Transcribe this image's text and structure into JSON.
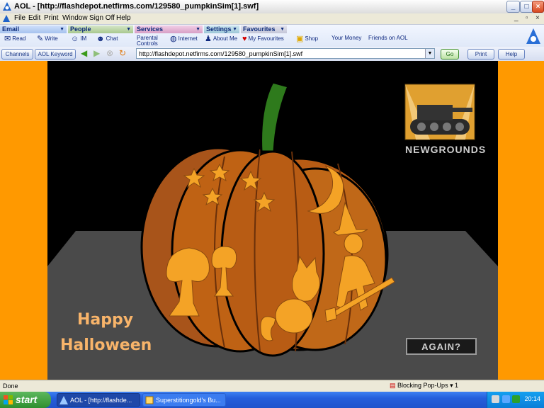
{
  "window": {
    "title": "AOL - [http://flashdepot.netfirms.com/129580_pumpkinSim[1].swf]"
  },
  "menu": [
    "File",
    "Edit",
    "Print",
    "Window",
    "Sign Off",
    "Help"
  ],
  "toolbar": {
    "groups": [
      {
        "label": "Email",
        "items": [
          "Read",
          "Write"
        ]
      },
      {
        "label": "People",
        "items": [
          "IM",
          "Chat"
        ]
      },
      {
        "label": "Services",
        "items": [
          "Parental Controls",
          "Internet",
          "About Me"
        ]
      },
      {
        "label": "Settings",
        "items": [
          "My Favourites"
        ]
      },
      {
        "label": "Favourites",
        "items": [
          "Shop",
          "Your Money",
          "Friends on AOL"
        ]
      }
    ]
  },
  "nav": {
    "channels_label": "Channels",
    "keyword_label": "AOL Keyword",
    "url": "http://flashdepot.netfirms.com/129580_pumpkinSim[1].swf",
    "go_label": "Go",
    "print_label": "Print",
    "help_label": "Help"
  },
  "flash": {
    "brand": "NEWGROUNDS",
    "greeting_line1": "Happy",
    "greeting_line2": "Halloween",
    "again_label": "AGAIN?"
  },
  "status": {
    "text": "Done",
    "popup_label": "Blocking Pop-Ups",
    "popup_count": "1"
  },
  "taskbar": {
    "start_label": "start",
    "tasks": [
      "AOL - [http://flashde...",
      "Superstitiongold's Bu..."
    ],
    "clock": "20:14"
  },
  "colors": {
    "page_bg": "#ff9900",
    "stage_bg": "#000000",
    "pumpkin": "#b85c14",
    "carving": "#f4a326",
    "text_orange": "#f8b46a"
  }
}
